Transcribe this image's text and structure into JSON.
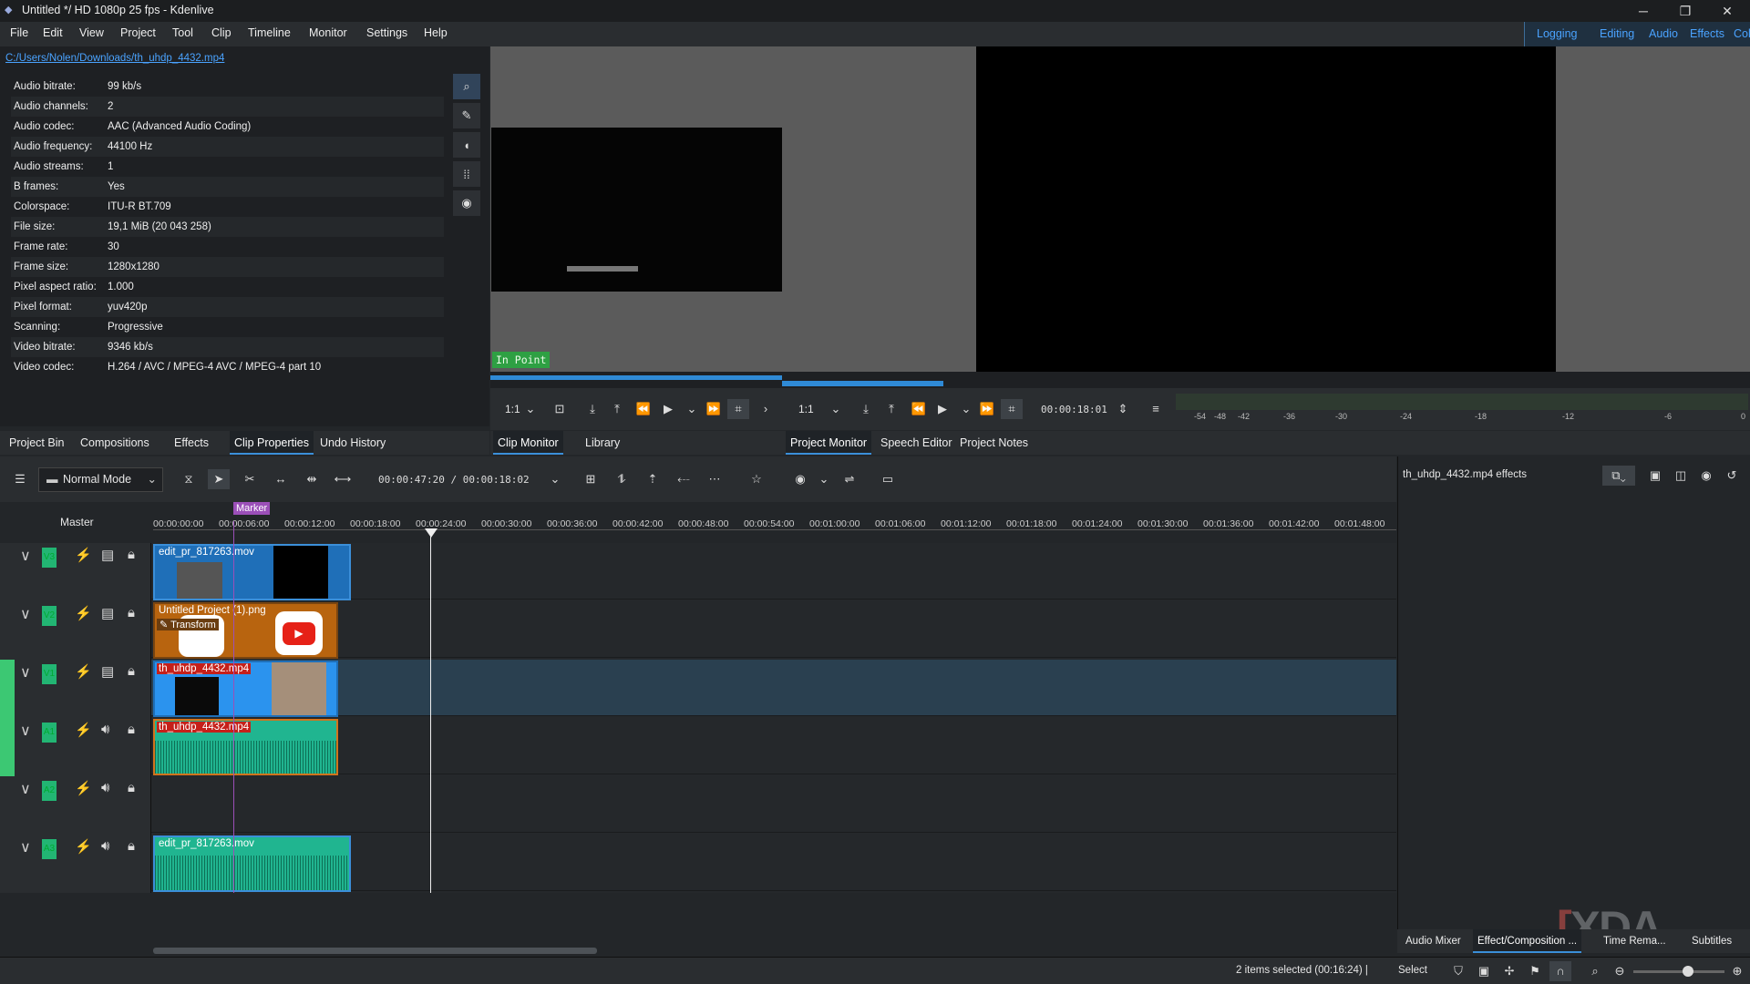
{
  "window": {
    "title": "Untitled */ HD 1080p 25 fps - Kdenlive",
    "minimize": "─",
    "restore": "❐",
    "close": "✕"
  },
  "menu": [
    "File",
    "Edit",
    "View",
    "Project",
    "Tool",
    "Clip",
    "Timeline",
    "Monitor",
    "Settings",
    "Help"
  ],
  "workspaces": [
    "Logging",
    "Editing",
    "Audio",
    "Effects",
    "Color"
  ],
  "clip_properties": {
    "path": "C:/Users/Nolen/Downloads/th_uhdp_4432.mp4",
    "rows": [
      {
        "k": "Audio bitrate:",
        "v": "99 kb/s"
      },
      {
        "k": "Audio channels:",
        "v": "2"
      },
      {
        "k": "Audio codec:",
        "v": "AAC (Advanced Audio Coding)"
      },
      {
        "k": "Audio frequency:",
        "v": "44100 Hz"
      },
      {
        "k": "Audio streams:",
        "v": "1"
      },
      {
        "k": "B frames:",
        "v": "Yes"
      },
      {
        "k": "Colorspace:",
        "v": "ITU-R BT.709"
      },
      {
        "k": "File size:",
        "v": "19,1 MiB (20 043 258)"
      },
      {
        "k": "Frame rate:",
        "v": "30"
      },
      {
        "k": "Frame size:",
        "v": "1280x1280"
      },
      {
        "k": "Pixel aspect ratio:",
        "v": "1.000"
      },
      {
        "k": "Pixel format:",
        "v": "yuv420p"
      },
      {
        "k": "Scanning:",
        "v": "Progressive"
      },
      {
        "k": "Video bitrate:",
        "v": "9346 kb/s"
      },
      {
        "k": "Video codec:",
        "v": "H.264 / AVC / MPEG-4 AVC / MPEG-4 part 10"
      }
    ]
  },
  "left_tabs": [
    "Project Bin",
    "Compositions",
    "Effects",
    "Clip Properties",
    "Undo History"
  ],
  "clip_monitor": {
    "in_point": "In Point",
    "zoom": "1:1",
    "tabs": [
      "Clip Monitor",
      "Library"
    ]
  },
  "project_monitor": {
    "zoom": "1:1",
    "timecode": "00:00:18:01",
    "tabs": [
      "Project Monitor",
      "Speech Editor",
      "Project Notes"
    ],
    "meter_labels": [
      "-54",
      "-48",
      "-42",
      "-36",
      "-30",
      "-24",
      "-18",
      "-12",
      "-6",
      "0"
    ]
  },
  "timeline": {
    "mode": "Normal Mode",
    "timecode": "00:00:47:20 / 00:00:18:02",
    "master": "Master",
    "marker": "Marker",
    "ruler": [
      "00:00:00:00",
      "00:00:06:00",
      "00:00:12:00",
      "00:00:18:00",
      "00:00:24:00",
      "00:00:30:00",
      "00:00:36:00",
      "00:00:42:00",
      "00:00:48:00",
      "00:00:54:00",
      "00:01:00:00",
      "00:01:06:00",
      "00:01:12:00",
      "00:01:18:00",
      "00:01:24:00",
      "00:01:30:00",
      "00:01:36:00",
      "00:01:42:00",
      "00:01:48:00"
    ],
    "tracks": [
      "V3",
      "V2",
      "V1",
      "A1",
      "A2",
      "A3"
    ],
    "clips": {
      "v3": "edit_pr_817263.mov",
      "v2": "Untitled Project (1).png",
      "v2_effect": "Transform",
      "v1": "th_uhdp_4432.mp4",
      "a1": "th_uhdp_4432.mp4",
      "a3": "edit_pr_817263.mov"
    }
  },
  "effect_panel": {
    "title": "th_uhdp_4432.mp4 effects"
  },
  "bottom_tabs": [
    "Audio Mixer",
    "Effect/Composition ...",
    "Time Rema...",
    "Subtitles"
  ],
  "status": {
    "selection": "2 items selected (00:16:24) |",
    "mode": "Select"
  },
  "watermark": "XDA"
}
